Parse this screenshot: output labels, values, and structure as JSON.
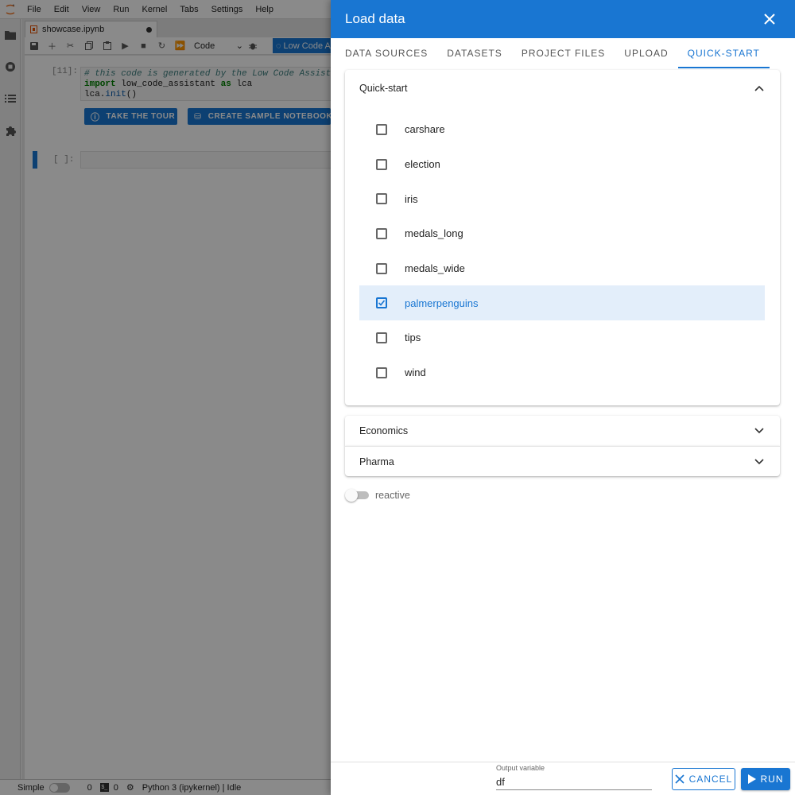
{
  "menubar": {
    "items": [
      "File",
      "Edit",
      "View",
      "Run",
      "Kernel",
      "Tabs",
      "Settings",
      "Help"
    ]
  },
  "notebook": {
    "tab_name": "showcase.ipynb",
    "cell_type": "Code",
    "lowcode_label": "Low Code A",
    "cell1_prompt": "[11]:",
    "code_line1": "# this code is generated by the Low Code Assistant",
    "code_import": "import",
    "code_module": " low_code_assistant ",
    "code_as": "as",
    "code_alias": " lca",
    "code_line3_obj": "lca.",
    "code_line3_fn": "init",
    "code_line3_end": "()",
    "tour_button": "TAKE THE TOUR",
    "sample_button": "CREATE SAMPLE NOTEBOOK",
    "cell2_prompt": "[ ]:"
  },
  "statusbar": {
    "mode": "Simple",
    "count1": "0",
    "count2": "0",
    "kernel": "Python 3 (ipykernel) | Idle"
  },
  "drawer": {
    "title": "Load data",
    "tabs": [
      "DATA SOURCES",
      "DATASETS",
      "PROJECT FILES",
      "UPLOAD",
      "QUICK-START"
    ],
    "active_tab": "QUICK-START",
    "quickstart": {
      "title": "Quick-start",
      "items": [
        {
          "label": "carshare",
          "checked": false
        },
        {
          "label": "election",
          "checked": false
        },
        {
          "label": "iris",
          "checked": false
        },
        {
          "label": "medals_long",
          "checked": false
        },
        {
          "label": "medals_wide",
          "checked": false
        },
        {
          "label": "palmerpenguins",
          "checked": true
        },
        {
          "label": "tips",
          "checked": false
        },
        {
          "label": "wind",
          "checked": false
        }
      ]
    },
    "economics_title": "Economics",
    "pharma_title": "Pharma",
    "reactive_label": "reactive",
    "output_label": "Output variable",
    "output_value": "df",
    "cancel_label": "CANCEL",
    "run_label": "RUN"
  },
  "colors": {
    "accent": "#1976d2",
    "selected_bg": "#e3eefa",
    "overlay": "rgba(0,0,0,0.46)"
  }
}
